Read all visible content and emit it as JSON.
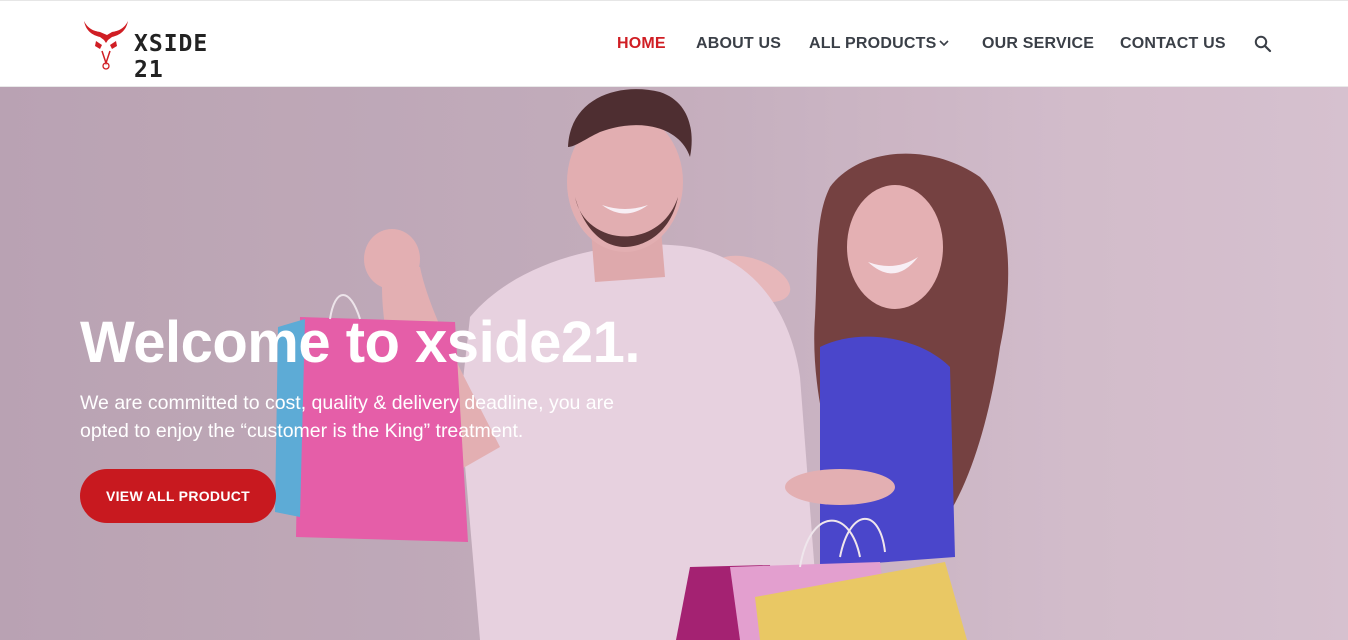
{
  "brand": {
    "name": "XSIDE 21",
    "accent": "#d01e24"
  },
  "nav": {
    "items": [
      {
        "label": "HOME",
        "active": true
      },
      {
        "label": "ABOUT US",
        "active": false
      },
      {
        "label": "ALL PRODUCTS",
        "active": false,
        "has_dropdown": true
      },
      {
        "label": "OUR SERVICE",
        "active": false
      },
      {
        "label": "CONTACT US",
        "active": false
      }
    ],
    "search_icon": "search-icon"
  },
  "hero": {
    "title": "Welcome to xside21.",
    "text": "We are committed to cost, quality & delivery deadline, you are opted to enjoy the “customer is the King” treatment.",
    "button_label": "VIEW ALL PRODUCT",
    "button_color": "#c8191f"
  }
}
